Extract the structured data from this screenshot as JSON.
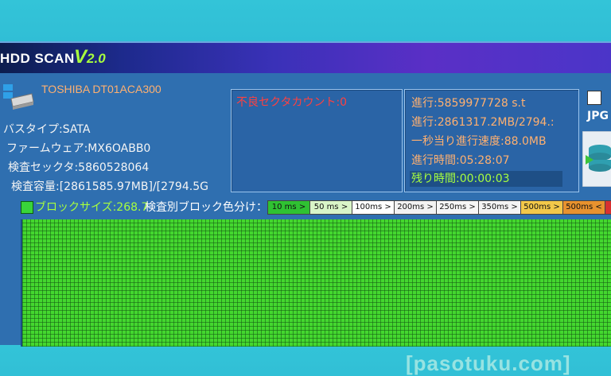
{
  "app": {
    "title": "HDD SCAN",
    "version_v": "V",
    "version_num": "2.0"
  },
  "drive": {
    "model": "TOSHIBA DT01ACA300",
    "bus_type": "バスタイプ:SATA",
    "firmware": "ファームウェア:MX6OABB0",
    "sectors": "検査セックタ:5860528064",
    "capacity": "検査容量:[2861585.97MB]/[2794.5G"
  },
  "status": {
    "bad_sector_count": "不良セクタカウント:0"
  },
  "progress": {
    "sectors": "進行:5859977728 s.t",
    "size": "進行:2861317.2MB/2794.:",
    "speed": "一秒当り進行速度:88.0MB",
    "elapsed": "進行時間:05:28:07",
    "remaining": "残り時間:00:00:03"
  },
  "options": {
    "jpg_label": "JPG"
  },
  "legend": {
    "block_size": "ブロックサイズ:268.7",
    "color_by": "検査別ブロック色分け：",
    "scale": [
      {
        "label": "10 ms >",
        "color": "#2fc232"
      },
      {
        "label": "50 ms >",
        "color": "#d9f5c8"
      },
      {
        "label": "100ms >",
        "color": "#ffffff"
      },
      {
        "label": "200ms >",
        "color": "#f2f2f2"
      },
      {
        "label": "250ms >",
        "color": "#f6f6f6"
      },
      {
        "label": "350ms >",
        "color": "#f4f4f4"
      },
      {
        "label": "500ms >",
        "color": "#f2c84a"
      },
      {
        "label": "500ms <",
        "color": "#e8922e"
      },
      {
        "label": "",
        "color": "#d83030"
      }
    ]
  },
  "watermark": "[pasotuku.com]",
  "colors": {
    "accent_green": "#a8ff3e",
    "model_orange": "#ffb070",
    "bad_red": "#ff4040",
    "panel_blue": "#2a64a6"
  }
}
